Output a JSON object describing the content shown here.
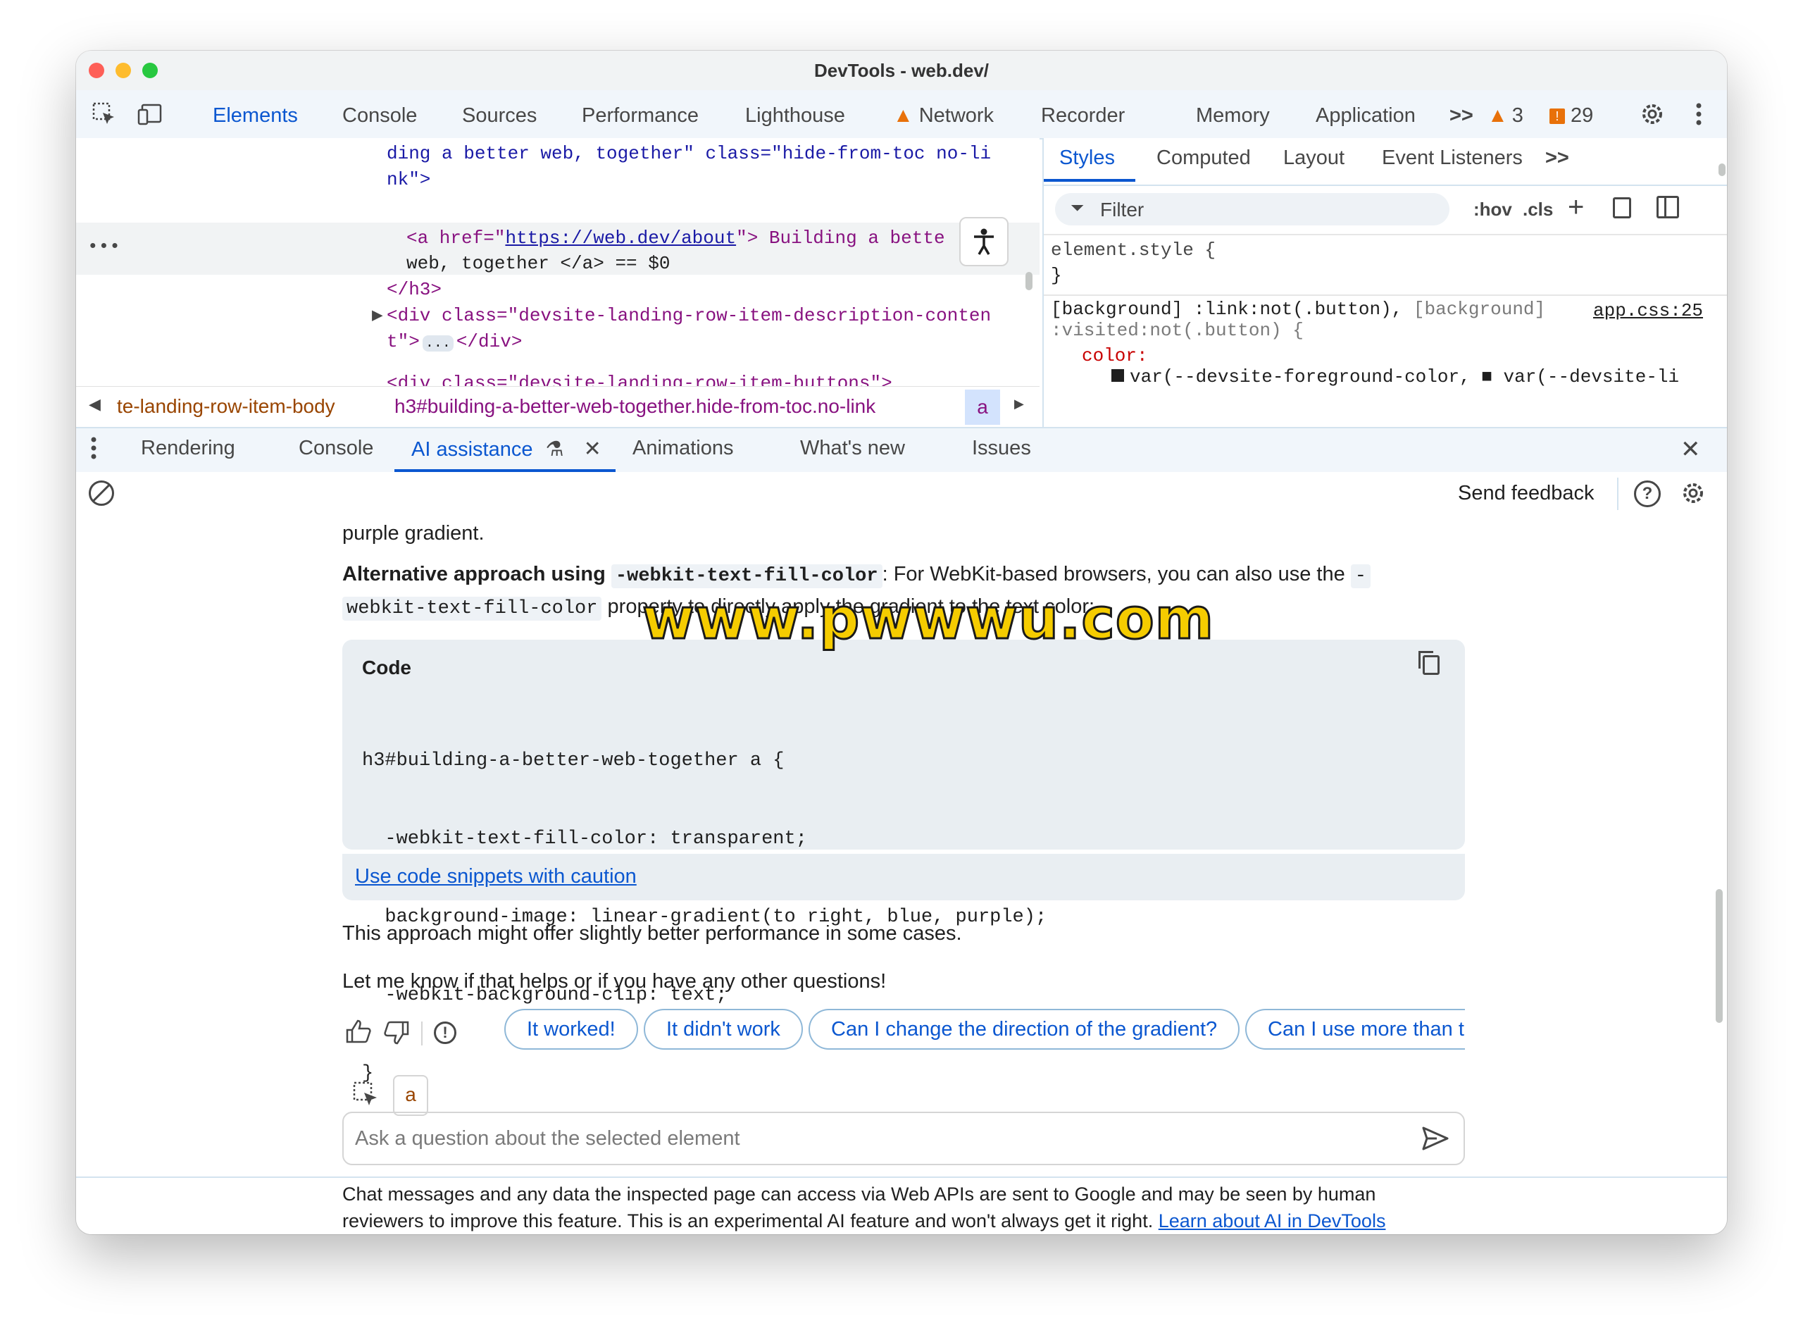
{
  "window": {
    "title": "DevTools - web.dev/"
  },
  "colors": {
    "accent": "#0b57d0",
    "warning": "#e8710a",
    "error": "#d93025",
    "tag": "#881280",
    "attr": "#994500",
    "value": "#1a1aa6"
  },
  "toolbar": {
    "tabs": [
      "Elements",
      "Console",
      "Sources",
      "Performance",
      "Lighthouse",
      "Network",
      "Recorder",
      "Memory",
      "Application"
    ],
    "more": ">>",
    "warnings": "3",
    "errors": "29"
  },
  "elements": {
    "line1": "ding a better web, together\" class=\"hide-from-toc no-li",
    "line2": "nk\">",
    "line3_tag": "<a href=\"",
    "line3_href": "https://web.dev/about",
    "line3_rest": "\"> Building a bette",
    "line4": "web, together </a> == $0",
    "line5": "</h3>",
    "line6": "<div class=\"devsite-landing-row-item-description-conten",
    "line7": "t\">",
    "line7_rest": "</div>",
    "line8": "<div class=\"devsite-landing-row-item-buttons\">",
    "ellipsis": "...",
    "dots": "•••"
  },
  "breadcrumb": {
    "item1": "te-landing-row-item-body",
    "item2": "h3#building-a-better-web-together.hide-from-toc.no-link",
    "item3": "a"
  },
  "styles": {
    "tabs": [
      "Styles",
      "Computed",
      "Layout",
      "Event Listeners"
    ],
    "more": ">>",
    "filter_placeholder": "Filter",
    "hov": ":hov",
    "cls": ".cls",
    "rule1_selector": "element.style {",
    "rule1_close": "}",
    "rule2_sel_a": "[background] :link:not(.button),",
    "rule2_sel_b": "[background]",
    "rule2_sel_c": ":visited:not(.button) {",
    "rule2_source": "app.css:25",
    "rule2_prop": "color:",
    "rule2_val": "var(--devsite-foreground-color, ■ var(--devsite-li"
  },
  "drawer": {
    "tabs": [
      "Rendering",
      "Console",
      "AI assistance",
      "Animations",
      "What's new",
      "Issues"
    ],
    "send_feedback": "Send feedback"
  },
  "chat": {
    "prev_text": "purple gradient.",
    "alt_bold": "Alternative approach using",
    "alt_code": "-webkit-text-fill-color",
    "alt_rest": ": For WebKit-based browsers, you can also use the",
    "alt_code2a": "-",
    "alt_code2b": "webkit-text-fill-color",
    "alt_rest2": "property to directly apply the gradient to the text color:",
    "code_label": "Code",
    "code_lines": [
      "h3#building-a-better-web-together a {",
      "  -webkit-text-fill-color: transparent;",
      "  background-image: linear-gradient(to right, blue, purple);",
      "  -webkit-background-clip: text;",
      "}"
    ],
    "caution_link": "Use code snippets with caution",
    "para1": "This approach might offer slightly better performance in some cases.",
    "para2": "Let me know if that helps or if you have any other questions!",
    "chips": [
      "It worked!",
      "It didn't work",
      "Can I change the direction of the gradient?",
      "Can I use more than t"
    ],
    "context_chip": "a",
    "input_placeholder": "Ask a question about the selected element",
    "footer_text1": "Chat messages and any data the inspected page can access via Web APIs are sent to Google and may be seen by human",
    "footer_text2": "reviewers to improve this feature. This is an experimental AI feature and won't always get it right.",
    "footer_link": "Learn about AI in DevTools"
  },
  "watermark": "www.pwwwu.com"
}
